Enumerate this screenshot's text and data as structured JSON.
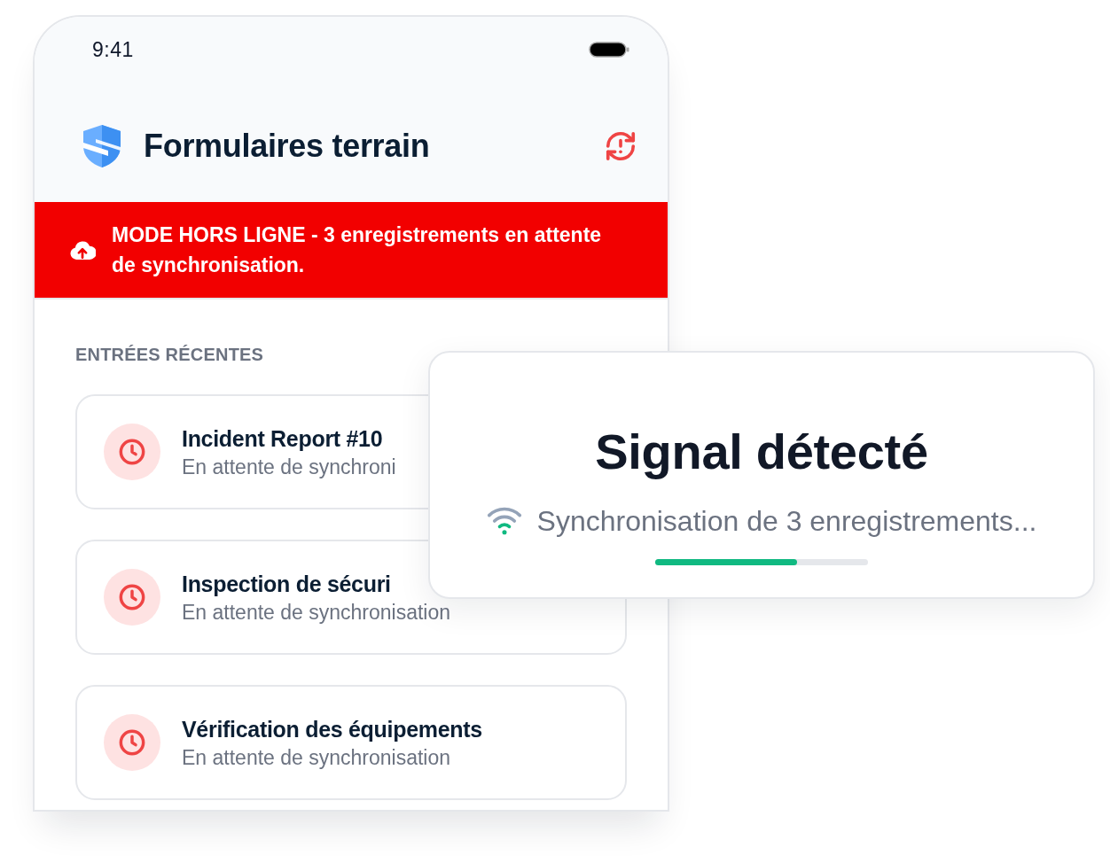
{
  "status_bar": {
    "time": "9:41"
  },
  "header": {
    "title": "Formulaires terrain"
  },
  "banner": {
    "text": "MODE HORS LIGNE - 3 enregistrements en attente de synchronisation."
  },
  "recent_entries": {
    "heading": "ENTRÉES RÉCENTES",
    "items": [
      {
        "title": "Incident Report #10",
        "status": "En attente de synchroni"
      },
      {
        "title": "Inspection de sécuri",
        "status": "En attente de synchronisation"
      },
      {
        "title": "Vérification des équipements",
        "status": "En attente de synchronisation"
      }
    ]
  },
  "sync_dialog": {
    "title": "Signal détecté",
    "message": "Synchronisation de 3 enregistrements...",
    "progress": {
      "level": 0.667
    }
  }
}
